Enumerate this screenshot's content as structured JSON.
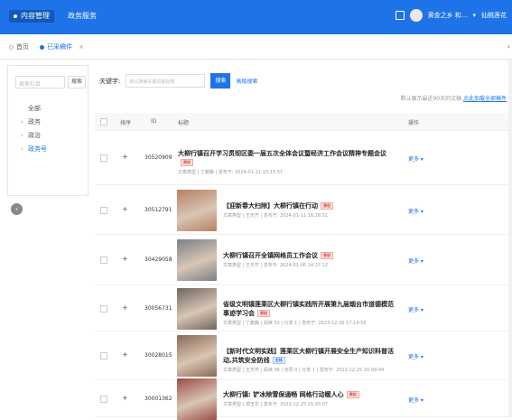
{
  "topbar": {
    "nav": [
      {
        "label": "内容管理",
        "active": true
      },
      {
        "label": "政务服务",
        "active": false
      }
    ],
    "user": "黄金之乡 和...",
    "site": "仙桃莲花",
    "colors": {
      "primary": "#1e73e8"
    }
  },
  "tabs": [
    {
      "label": "首页",
      "active": false
    },
    {
      "label": "已采稿件",
      "active": true
    }
  ],
  "sidebar": {
    "search_placeholder": "搜索栏目",
    "search_button": "搜索",
    "tree": [
      {
        "label": "全部",
        "expandable": false,
        "selected": false
      },
      {
        "label": "政务",
        "expandable": true,
        "selected": false
      },
      {
        "label": "政治",
        "expandable": true,
        "selected": false
      },
      {
        "label": "政务号",
        "expandable": true,
        "selected": true
      }
    ]
  },
  "search": {
    "label": "关键字:",
    "placeholder": "默认搜索关键词或标题",
    "button": "搜索",
    "advanced": "高级搜索"
  },
  "note": {
    "text": "默认展示最近90天的文稿,",
    "link": "点此加载全部稿件"
  },
  "table": {
    "headers": [
      "排序",
      "ID",
      "标题",
      "操作"
    ],
    "rows": [
      {
        "id": "30520909",
        "title": "大柳行镇召开学习贯彻区委一届五次全体会议暨经济工作会议精神专题会议",
        "tag": "原创",
        "tag_color": "red",
        "meta": "文章类型 | 丁鹏静 | 发布于: 2024-01-11 15:15:57",
        "action": "更多",
        "thumb": false
      },
      {
        "id": "30512791",
        "title": "【迎新春大扫除】大柳行镇在行动",
        "tag": "原创",
        "tag_color": "red",
        "meta": "文章类型 | 王天齐 | 发布于: 2024-01-11 16:28:51",
        "action": "更多",
        "thumb": true,
        "thumb_color": "#b87f62"
      },
      {
        "id": "30429058",
        "title": "大柳行镇召开全镇网格员工作会议",
        "tag": "原创",
        "tag_color": "red",
        "meta": "文章类型 | 王天齐 | 发布于: 2024-01-06 14:27:12",
        "action": "更多",
        "thumb": true,
        "thumb_color": "#7a8088"
      },
      {
        "id": "30056731",
        "title": "省级文明镇莲莱区大柳行镇实践所开展第九届烟台市道德模范事迹学习会",
        "tag": "原创",
        "tag_color": "red",
        "meta": "文章类型 | 丁鹏静 | 阅读 33 | 分享 1 | 发布于: 2023-12-26 17:14:55",
        "action": "更多",
        "thumb": true,
        "thumb_color": "#6e665e"
      },
      {
        "id": "30028015",
        "title": "【新时代文明实践】莲莱区大柳行镇开展安全生产知识科普活动,共筑安全防线",
        "tag": "主线",
        "tag_color": "blue",
        "meta": "文章类型 | 王天齐 | 阅读 36 | 点赞 0 | 分享 1 | 发布于: 2023-12-25 10:09:49",
        "action": "更多",
        "thumb": true,
        "thumb_color": "#8a6a55"
      },
      {
        "id": "30001362",
        "title": "大柳行镇: 铲冰除雪保通畅 网格行动暖人心",
        "tag": "原创",
        "tag_color": "red",
        "meta": "文章类型 | 郭玉华 | 发布于: 2023-12-25 15:55:07",
        "action": "更多",
        "thumb": true,
        "thumb_color": "#9a4d48"
      }
    ]
  }
}
